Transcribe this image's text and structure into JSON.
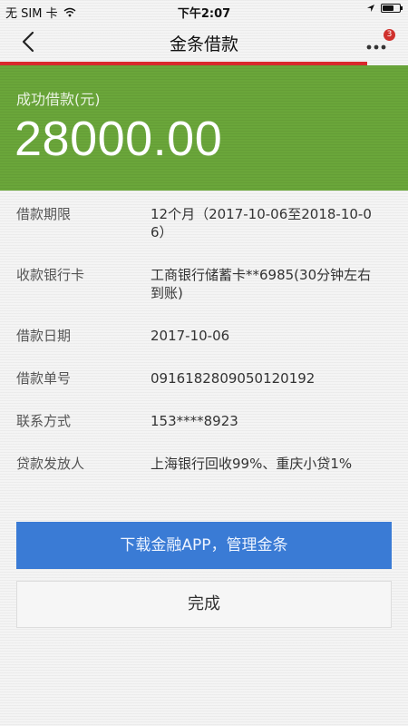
{
  "status_bar": {
    "carrier": "无 SIM 卡",
    "wifi_icon": "wifi-icon",
    "time": "下午2:07",
    "location_icon": "location-arrow-icon",
    "battery_icon": "battery-icon",
    "battery_level": 0.7
  },
  "nav": {
    "back_icon": "chevron-left-icon",
    "title": "金条借款",
    "more_icon": "more-dots-icon",
    "badge_count": "3"
  },
  "progress": {
    "value": 0.9,
    "color": "#d8282c"
  },
  "hero": {
    "label": "成功借款(元)",
    "amount": "28000.00",
    "background_color": "#6aa63a"
  },
  "details": [
    {
      "label": "借款期限",
      "value": "12个月（2017-10-06至2018-10-06）"
    },
    {
      "label": "收款银行卡",
      "value": "工商银行储蓄卡**6985(30分钟左右到账)"
    },
    {
      "label": "借款日期",
      "value": "2017-10-06"
    },
    {
      "label": "借款单号",
      "value": "0916182809050120192"
    },
    {
      "label": "联系方式",
      "value": "153****8923"
    },
    {
      "label": "贷款发放人",
      "value": "上海银行回收99%、重庆小贷1%"
    }
  ],
  "buttons": {
    "primary_label": "下载金融APP，管理金条",
    "primary_color": "#3a7bd5",
    "secondary_label": "完成"
  }
}
